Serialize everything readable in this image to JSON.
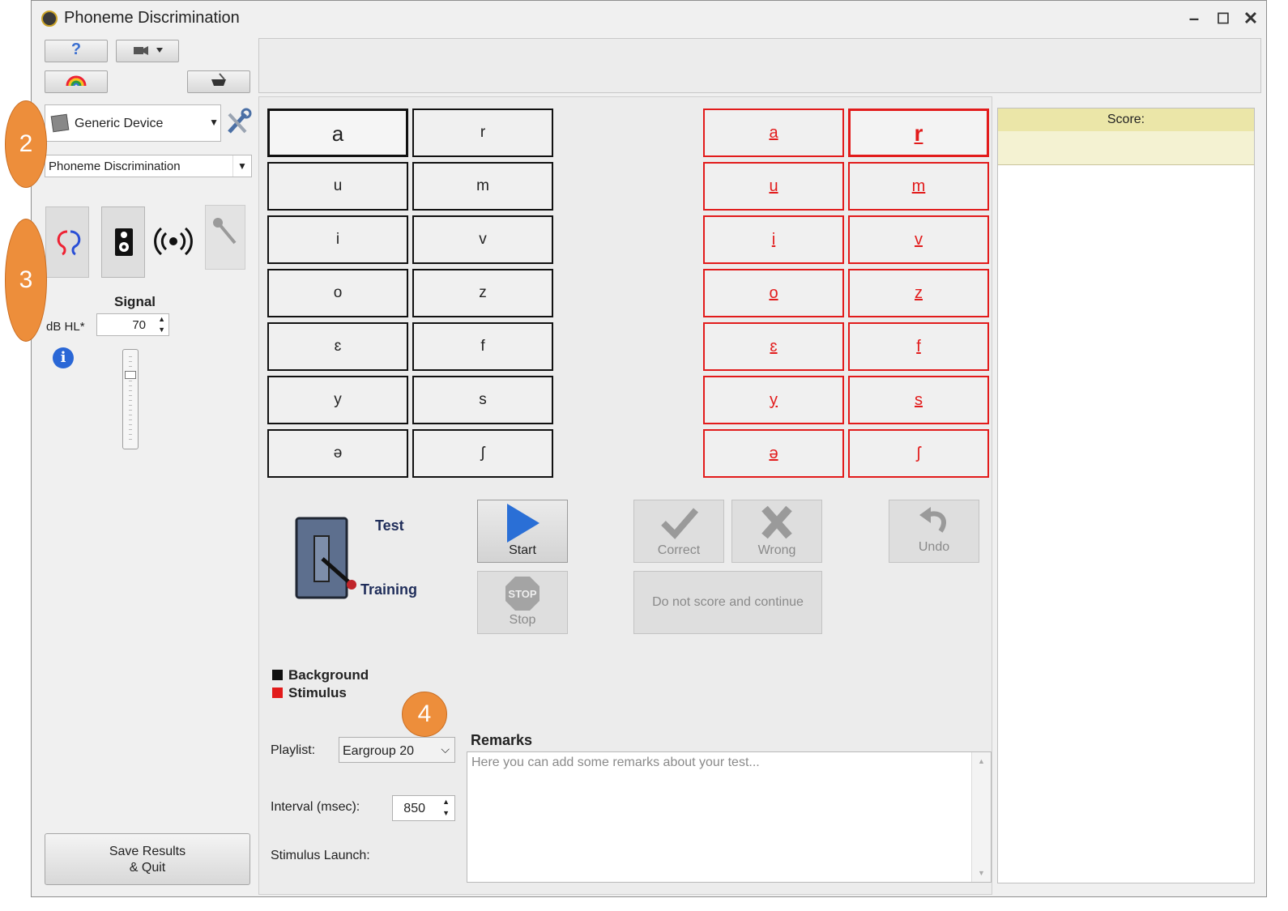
{
  "window": {
    "title": "Phoneme Discrimination",
    "minimize": "–",
    "maximize": "☐",
    "close": "✕"
  },
  "left": {
    "device": "Generic Device",
    "test_type": "Phoneme Discrimination",
    "signal_label": "Signal",
    "db_label": "dB HL*",
    "db_value": "70",
    "save_quit_line1": "Save Results",
    "save_quit_line2": "& Quit"
  },
  "badges": {
    "b2": "2",
    "b3": "3",
    "b4": "4"
  },
  "phonemes": {
    "background": [
      "a",
      "r",
      "u",
      "m",
      "i",
      "v",
      "o",
      "z",
      "ɛ",
      "f",
      "y",
      "s",
      "ə",
      "ʃ"
    ],
    "stimulus": [
      "a",
      "r",
      "u",
      "m",
      "i",
      "v",
      "o",
      "z",
      "ɛ",
      "f",
      "y",
      "s",
      "ə",
      "ʃ"
    ]
  },
  "mode": {
    "test": "Test",
    "training": "Training"
  },
  "actions": {
    "start": "Start",
    "stop": "Stop",
    "stop_sign": "STOP",
    "correct": "Correct",
    "wrong": "Wrong",
    "undo": "Undo",
    "do_not_score": "Do not score and continue"
  },
  "legend": {
    "background": "Background",
    "stimulus": "Stimulus"
  },
  "settings": {
    "playlist_label": "Playlist:",
    "playlist_value": "Eargroup 20",
    "interval_label": "Interval (msec):",
    "interval_value": "850",
    "launch_label": "Stimulus Launch:"
  },
  "remarks": {
    "title": "Remarks",
    "placeholder": "Here you can add some remarks about your test..."
  },
  "score": {
    "label": "Score:"
  },
  "colors": {
    "stimulus_red": "#e21b1b",
    "badge_orange": "#ed8e3b",
    "start_blue": "#2a6fd6"
  }
}
